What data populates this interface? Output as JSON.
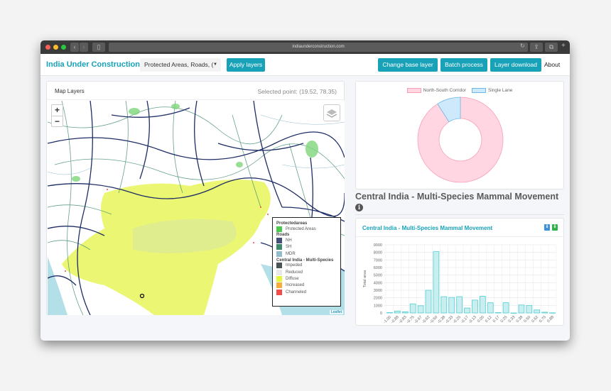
{
  "browser": {
    "url": "indiaunderconstruction.com",
    "icons": [
      "back-icon",
      "forward-icon",
      "sidebar-icon",
      "reload-icon",
      "share-icon",
      "tabs-icon",
      "new-tab-icon"
    ]
  },
  "navbar": {
    "brand": "India Under Construction",
    "layer_select_value": "Protected Areas, Roads, (",
    "apply_label": "Apply layers",
    "change_base_label": "Change base layer",
    "batch_label": "Batch process",
    "download_label": "Layer download",
    "about_label": "About"
  },
  "map_panel": {
    "title": "Map Layers",
    "selected_point": "Selected point: (19.52, 78.35)",
    "zoom_in": "+",
    "zoom_out": "−",
    "attribution": "Leaflet",
    "legend": {
      "groups": [
        {
          "header": "Protectedareas",
          "items": [
            {
              "label": "Protected Areas",
              "color": "#4cc84a"
            }
          ]
        },
        {
          "header": "Roads",
          "items": [
            {
              "label": "NH",
              "color": "#45507a"
            },
            {
              "label": "SH",
              "color": "#3f8a6c"
            },
            {
              "label": "MDR",
              "color": "#93bccf"
            }
          ]
        },
        {
          "header": "Central India - Multi-Species",
          "items": [
            {
              "label": "Impeded",
              "color": "#4a5558"
            },
            {
              "label": "Reduced",
              "color": "#e8e8e8"
            },
            {
              "label": "Diffuse",
              "color": "#e4f53c"
            },
            {
              "label": "Increased",
              "color": "#fbaa3c"
            },
            {
              "label": "Channeled",
              "color": "#f44b4b"
            }
          ]
        }
      ]
    }
  },
  "section_title": "Central India - Multi-Species Mammal Movement",
  "bar_panel": {
    "title": "Central India - Multi-Species Mammal Movement"
  },
  "chart_data": [
    {
      "type": "pie",
      "subtype": "doughnut",
      "labels": [
        "North-South Corridor",
        "Single Lane"
      ],
      "values": [
        91,
        9
      ],
      "colors": {
        "fill": [
          "#ffd6e1",
          "#cde9fb"
        ],
        "stroke": [
          "#f5a0b7",
          "#6cb8e8"
        ]
      },
      "legend": "top"
    },
    {
      "type": "bar",
      "title": "",
      "xlabel": "",
      "ylabel": "Total area",
      "ylim": [
        0,
        9000
      ],
      "yticks": [
        0,
        1000,
        2000,
        3000,
        4000,
        5000,
        6000,
        7000,
        8000,
        9000
      ],
      "grid": true,
      "categories": [
        "-1.00",
        "-0.88",
        "-0.83",
        "-0.75",
        "-0.67",
        "-0.62",
        "-0.50",
        "-0.38",
        "-0.33",
        "-0.25",
        "-0.17",
        "-0.13",
        "0.00",
        "0.12",
        "0.17",
        "0.25",
        "0.33",
        "0.38",
        "0.50",
        "0.62",
        "0.75",
        "0.88"
      ],
      "values": [
        50,
        250,
        150,
        1200,
        950,
        3000,
        8100,
        2150,
        2050,
        2150,
        650,
        1700,
        2200,
        1350,
        50,
        1350,
        0,
        1050,
        1000,
        400,
        100,
        20
      ],
      "colors": {
        "fill": "#c8eef0",
        "stroke": "#4fcfd3"
      }
    }
  ]
}
